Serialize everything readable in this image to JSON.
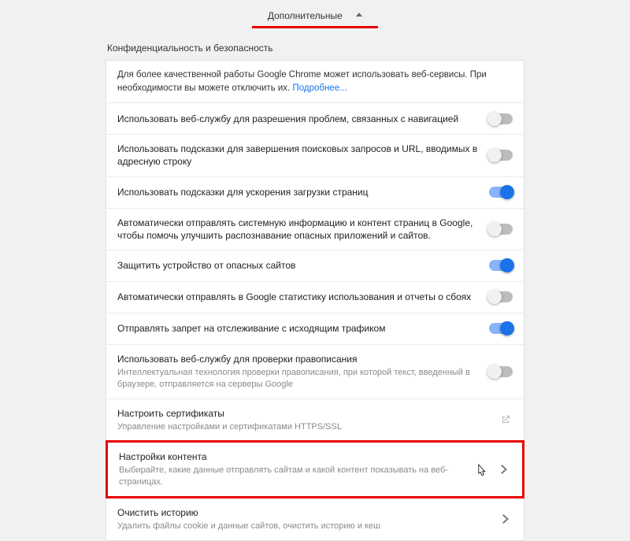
{
  "advanced_label": "Дополнительные",
  "section_title": "Конфиденциальность и безопасность",
  "intro": {
    "text": "Для более качественной работы Google Chrome может использовать веб-сервисы. При необходимости вы можете отключить их. ",
    "link": "Подробнее..."
  },
  "rows": [
    {
      "title": "Использовать веб-службу для разрешения проблем, связанных с навигацией",
      "on": false
    },
    {
      "title": "Использовать подсказки для завершения поисковых запросов и URL, вводимых в адресную строку",
      "on": false
    },
    {
      "title": "Использовать подсказки для ускорения загрузки страниц",
      "on": true
    },
    {
      "title": "Автоматически отправлять системную информацию и контент страниц в Google, чтобы помочь улучшить распознавание опасных приложений и сайтов.",
      "on": false
    },
    {
      "title": "Защитить устройство от опасных сайтов",
      "on": true
    },
    {
      "title": "Автоматически отправлять в Google статистику использования и отчеты о сбоях",
      "on": false
    },
    {
      "title": "Отправлять запрет на отслеживание с исходящим трафиком",
      "on": true
    },
    {
      "title": "Использовать веб-службу для проверки правописания",
      "sub": "Интеллектуальная технология проверки правописания, при которой текст, введенный в браузере, отправляется на серверы Google",
      "on": false
    }
  ],
  "certs": {
    "title": "Настроить сертификаты",
    "sub": "Управление настройками и сертификатами HTTPS/SSL"
  },
  "content_settings": {
    "title": "Настройки контента",
    "sub": "Выбирайте, какие данные отправлять сайтам и какой контент показывать на веб-страницах."
  },
  "clear_history": {
    "title": "Очистить историю",
    "sub": "Удалить файлы cookie и данные сайтов, очистить историю и кеш"
  }
}
